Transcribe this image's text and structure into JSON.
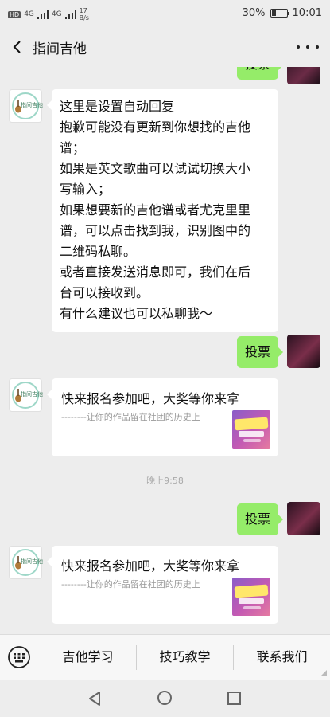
{
  "status_bar": {
    "network_left": "HD",
    "network_1": "4G",
    "network_2": "4G",
    "speed_value": "17",
    "speed_unit": "B/s",
    "battery": "30%",
    "battery_level": 0.3,
    "time": "10:01"
  },
  "header": {
    "title": "指间吉他"
  },
  "messages": {
    "top_partial_label": "投票",
    "auto_reply": [
      "这里是设置自动回复",
      "抱歉可能没有更新到你想找的吉他",
      "谱；",
      "如果是英文歌曲可以试试切换大小",
      "写输入；",
      "如果想要新的吉他谱或者尤克里里",
      "谱，可以点击找到我，识别图中的",
      "二维码私聊。",
      "或者直接发送消息即可，我们在后",
      "台可以接收到。",
      "有什么建议也可以私聊我～"
    ],
    "vote_1": "投票",
    "card_1": {
      "title": "快来报名参加吧，大奖等你来拿",
      "desc": "--------让你的作品留在社团的历史上"
    },
    "timestamp": "晚上9:58",
    "vote_2": "投票",
    "card_2": {
      "title": "快来报名参加吧，大奖等你来拿",
      "desc": "--------让你的作品留在社团的历史上"
    }
  },
  "bottom_menu": {
    "items": [
      {
        "label": "吉他学习"
      },
      {
        "label": "技巧教学"
      },
      {
        "label": "联系我们"
      }
    ]
  },
  "icons": [
    "back-icon",
    "more-icon",
    "keyboard-icon",
    "nav-back-icon",
    "nav-home-icon",
    "nav-recent-icon"
  ],
  "colors": {
    "user_bubble": "#95ec69",
    "background": "#ededed",
    "bot_bubble": "#ffffff"
  }
}
